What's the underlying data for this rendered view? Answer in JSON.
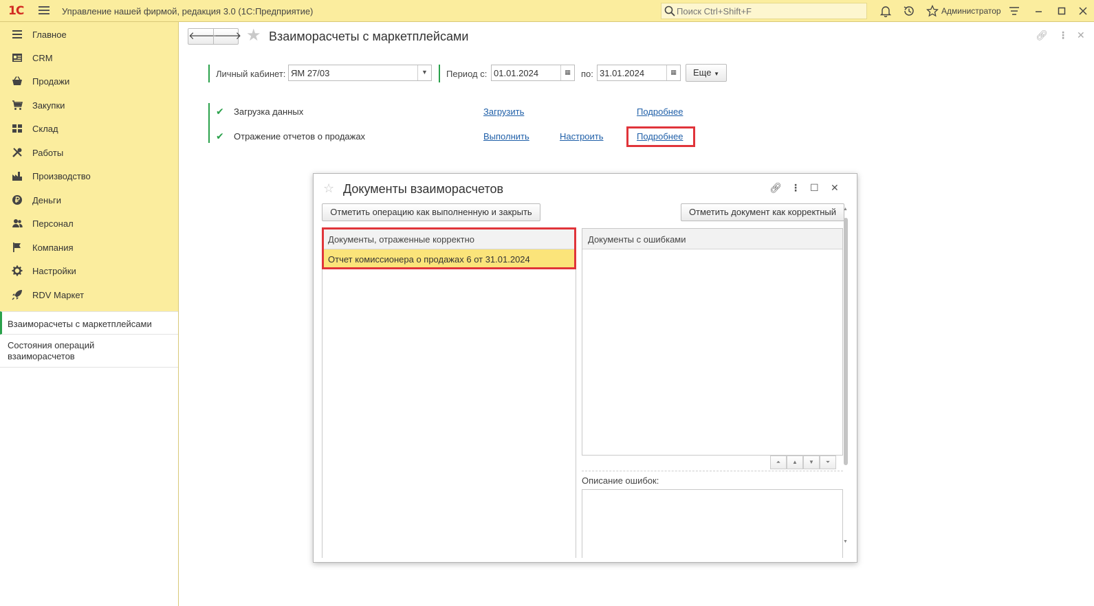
{
  "topbar": {
    "logo": "1С",
    "app_title": "Управление нашей фирмой, редакция 3.0  (1С:Предприятие)",
    "search_placeholder": "Поиск Ctrl+Shift+F",
    "user": "Администратор"
  },
  "sidebar": {
    "items": [
      {
        "label": "Главное",
        "icon": "list-icon"
      },
      {
        "label": "CRM",
        "icon": "crm-icon"
      },
      {
        "label": "Продажи",
        "icon": "basket-icon"
      },
      {
        "label": "Закупки",
        "icon": "cart-icon"
      },
      {
        "label": "Склад",
        "icon": "warehouse-icon"
      },
      {
        "label": "Работы",
        "icon": "tools-icon"
      },
      {
        "label": "Производство",
        "icon": "factory-icon"
      },
      {
        "label": "Деньги",
        "icon": "ruble-icon"
      },
      {
        "label": "Персонал",
        "icon": "people-icon"
      },
      {
        "label": "Компания",
        "icon": "flag-icon"
      },
      {
        "label": "Настройки",
        "icon": "gear-icon"
      },
      {
        "label": "RDV Маркет",
        "icon": "rocket-icon"
      }
    ],
    "subitems": [
      {
        "label": "Взаиморасчеты с маркетплейсами"
      },
      {
        "label": "Состояния операций взаиморасчетов"
      }
    ]
  },
  "main": {
    "title": "Взаиморасчеты с маркетплейсами",
    "filters": {
      "cabinet_label": "Личный кабинет:",
      "cabinet_value": "ЯМ 27/03",
      "period_from_label": "Период с:",
      "period_from": "01.01.2024",
      "period_to_label": "по:",
      "period_to": "31.01.2024",
      "more_label": "Еще"
    },
    "operations": [
      {
        "label": "Загрузка данных",
        "action": "Загрузить",
        "details": "Подробнее"
      },
      {
        "label": "Отражение отчетов о продажах",
        "action": "Выполнить",
        "configure": "Настроить",
        "details": "Подробнее"
      }
    ]
  },
  "dialog": {
    "title": "Документы взаиморасчетов",
    "btn_mark_done": "Отметить операцию как выполненную и закрыть",
    "btn_mark_correct": "Отметить документ как корректный",
    "correct_header": "Документы, отраженные корректно",
    "correct_rows": [
      "Отчет комиссионера о продажах 6 от 31.01.2024"
    ],
    "errors_header": "Документы с ошибками",
    "errors_desc_label": "Описание ошибок:"
  },
  "colors": {
    "panel_yellow": "#fbed9e",
    "accent_green": "#2aa14b",
    "link_blue": "#1f5fa8",
    "highlight_red": "#e0343a",
    "selected_row": "#fbe47a"
  }
}
